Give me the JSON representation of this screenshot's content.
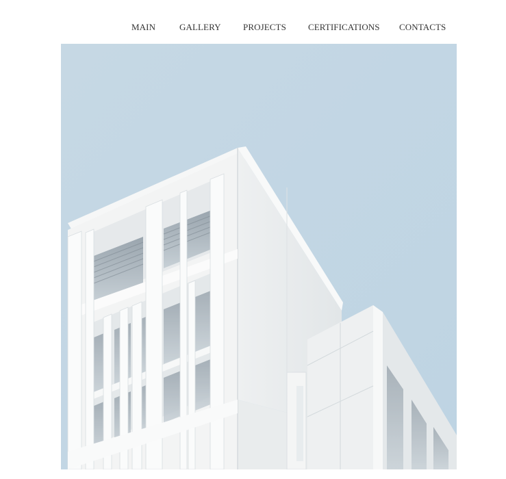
{
  "nav": {
    "items": [
      {
        "label": "MAIN"
      },
      {
        "label": "GALLERY"
      },
      {
        "label": "PROJECTS"
      },
      {
        "label": "CERTIFICATIONS"
      },
      {
        "label": "CONTACTS"
      }
    ]
  },
  "hero": {
    "subject": "white-modern-building-photo",
    "colors": {
      "sky": "#c5d8e5",
      "facade": "#f2f3f3",
      "shadow": "#dfe3e6",
      "window": "#8f9aa3"
    }
  }
}
